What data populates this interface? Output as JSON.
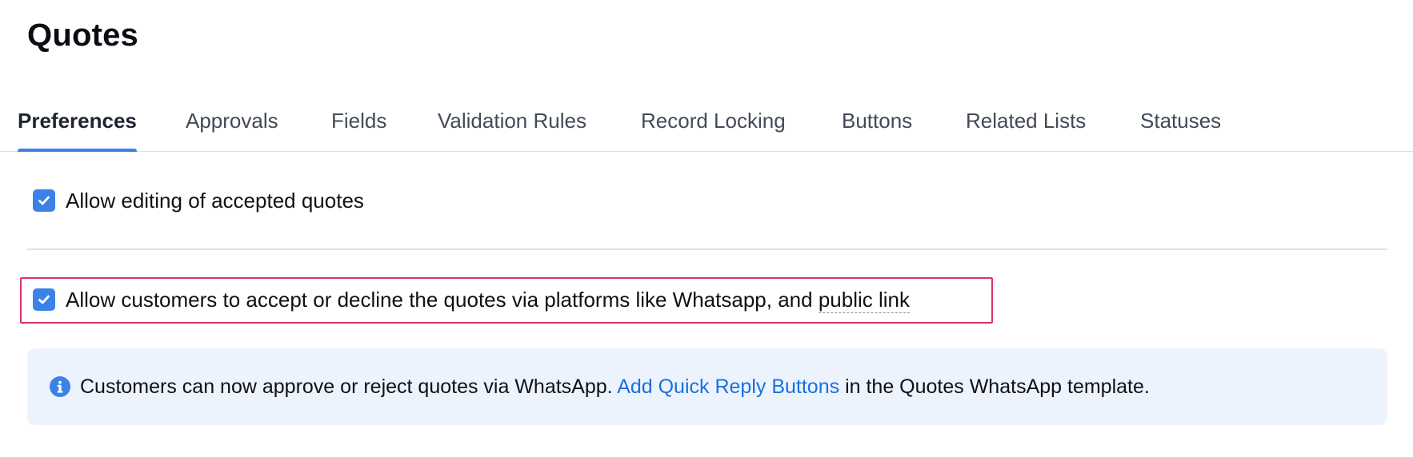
{
  "page": {
    "title": "Quotes"
  },
  "tabs": [
    {
      "label": "Preferences",
      "active": true
    },
    {
      "label": "Approvals"
    },
    {
      "label": "Fields"
    },
    {
      "label": "Validation Rules"
    },
    {
      "label": "Record Locking"
    },
    {
      "label": "Buttons"
    },
    {
      "label": "Related Lists"
    },
    {
      "label": "Statuses"
    }
  ],
  "settings": {
    "allow_editing": {
      "label": "Allow editing of accepted quotes",
      "checked": true
    },
    "allow_customers": {
      "label_prefix": "Allow customers to accept or decline the quotes via platforms like Whatsapp, and ",
      "link_text": "public link",
      "checked": true
    }
  },
  "info_banner": {
    "icon": "info-icon",
    "text_before": "Customers can now approve or reject quotes via WhatsApp.",
    "link_text": "Add Quick Reply Buttons",
    "text_after": "in the Quotes WhatsApp template."
  },
  "colors": {
    "accent": "#3b82e8",
    "highlight_border": "#d6336c",
    "link": "#1a6fdf",
    "banner_bg": "#edf3fd"
  }
}
